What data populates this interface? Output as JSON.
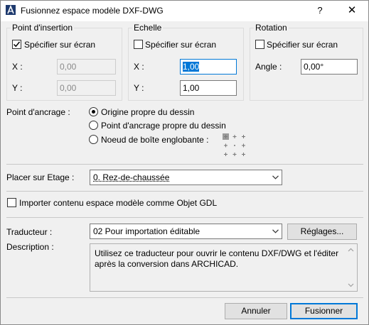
{
  "window": {
    "title": "Fusionnez espace modèle DXF-DWG",
    "help": "?",
    "close": "✕"
  },
  "insertion": {
    "title": "Point d'insertion",
    "specify_label": "Spécifier sur écran",
    "specify_checked": true,
    "x_label": "X :",
    "x_value": "0,00",
    "y_label": "Y :",
    "y_value": "0,00"
  },
  "scale": {
    "title": "Echelle",
    "specify_label": "Spécifier sur écran",
    "specify_checked": false,
    "x_label": "X :",
    "x_value": "1,00",
    "y_label": "Y :",
    "y_value": "1,00"
  },
  "rotation": {
    "title": "Rotation",
    "specify_label": "Spécifier sur écran",
    "specify_checked": false,
    "angle_label": "Angle :",
    "angle_value": "0,00°"
  },
  "anchor": {
    "label": "Point d'ancrage :",
    "options": [
      "Origine propre du dessin",
      "Point d'ancrage propre du dessin",
      "Noeud de boîte englobante :"
    ],
    "selected_index": 0
  },
  "story": {
    "label": "Placer sur Etage :",
    "value": "0. Rez-de-chaussée"
  },
  "import_gdl": {
    "label": "Importer contenu espace modèle comme Objet GDL",
    "checked": false
  },
  "translator": {
    "label": "Traducteur :",
    "value": "02 Pour importation éditable",
    "settings_button": "Réglages...",
    "description_label": "Description :",
    "description": "Utilisez ce traducteur pour ouvrir le contenu DXF/DWG et l'éditer après la conversion dans ARCHICAD."
  },
  "footer": {
    "cancel": "Annuler",
    "ok": "Fusionner"
  },
  "colors": {
    "accent": "#0078d7",
    "dialog_bg": "#f0f0f0"
  },
  "icons": [
    "archicad-logo-icon",
    "help-icon",
    "close-icon",
    "checkmark-icon",
    "chevron-down-icon",
    "bounding-box-node-icon"
  ]
}
